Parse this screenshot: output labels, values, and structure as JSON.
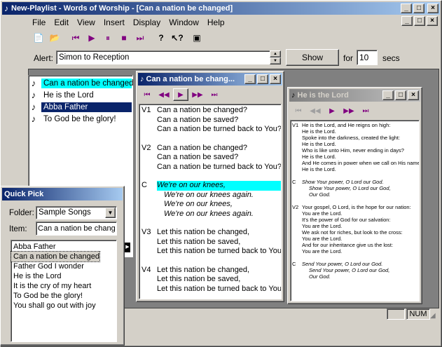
{
  "app": {
    "title": "New-Playlist - Words of Worship - [Can a nation be changed]"
  },
  "menu": [
    "File",
    "Edit",
    "View",
    "Insert",
    "Display",
    "Window",
    "Help"
  ],
  "alert": {
    "label": "Alert:",
    "value": "Simon to Reception",
    "show_label": "Show",
    "for_label": "for",
    "secs_value": "10",
    "secs_label": "secs"
  },
  "playlist": {
    "items": [
      {
        "label": "Can a nation be changed",
        "state": "highlighted"
      },
      {
        "label": "He is the Lord",
        "state": "normal"
      },
      {
        "label": "Abba Father",
        "state": "selected"
      },
      {
        "label": "To God be the glory!",
        "state": "normal"
      }
    ]
  },
  "song_window_1": {
    "title": "Can a nation be chang...",
    "verses": [
      {
        "label": "V1",
        "lines": [
          "Can a nation be changed?",
          "Can a nation be saved?",
          "Can a nation be turned back to You?"
        ],
        "italic": false,
        "highlight": false
      },
      {
        "label": "V2",
        "lines": [
          "Can a nation be changed?",
          "Can a nation be saved?",
          "Can a nation be turned back to You?"
        ],
        "italic": false,
        "highlight": false
      },
      {
        "label": "C",
        "lines": [
          "We're on our knees,",
          "We're on our knees again.",
          "We're on our knees,",
          "We're on our knees again."
        ],
        "italic": true,
        "highlight": true
      },
      {
        "label": "V3",
        "lines": [
          "Let this nation be changed,",
          "Let this nation be saved,",
          "Let this nation be turned back to You."
        ],
        "italic": false,
        "highlight": false
      },
      {
        "label": "V4",
        "lines": [
          "Let this nation be changed,",
          "Let this nation be saved,",
          "Let this nation be turned back to You."
        ],
        "italic": false,
        "highlight": false
      }
    ]
  },
  "song_window_2": {
    "title": "He is the Lord",
    "verses": [
      {
        "label": "V1",
        "lines": [
          "He is the Lord, and He reigns on high:",
          "He is the Lord.",
          "Spoke into the darkness, created the light:",
          "He is the Lord.",
          "Who is like unto Him, never ending in days?",
          "He is the Lord.",
          "And He comes in power when we call on His name:",
          "",
          "He is the Lord."
        ],
        "italic": false
      },
      {
        "label": "C",
        "lines": [
          "Show Your power, O Lord our God.",
          "Show Your power, O Lord our God,",
          "Our God."
        ],
        "italic": true
      },
      {
        "label": "V2",
        "lines": [
          "Your gospel, O Lord, is the hope for our nation:",
          "You are the Lord.",
          "It's the power of God for our salvation:",
          "You are the Lord.",
          "We ask not for riches, but look to the cross:",
          "You are the Lord.",
          "And for our inheritance give us the lost:",
          "You are the Lord."
        ],
        "italic": false
      },
      {
        "label": "C",
        "lines": [
          "Send Your power, O Lord our God.",
          "Send Your power, O Lord our God,",
          "Our God."
        ],
        "italic": true
      }
    ]
  },
  "quick_pick": {
    "title": "Quick Pick",
    "folder_label": "Folder:",
    "folder_value": "Sample Songs",
    "item_label": "Item:",
    "item_value": "Can a nation be chang",
    "songs": [
      {
        "label": "Abba Father",
        "selected": false
      },
      {
        "label": "Can a nation be changed",
        "selected": true
      },
      {
        "label": "Father God I wonder",
        "selected": false
      },
      {
        "label": "He is the Lord",
        "selected": false
      },
      {
        "label": "It is the cry of my heart",
        "selected": false
      },
      {
        "label": "To God be the glory!",
        "selected": false
      },
      {
        "label": "You shall go out with joy",
        "selected": false
      }
    ]
  },
  "status": {
    "num": "NUM"
  }
}
